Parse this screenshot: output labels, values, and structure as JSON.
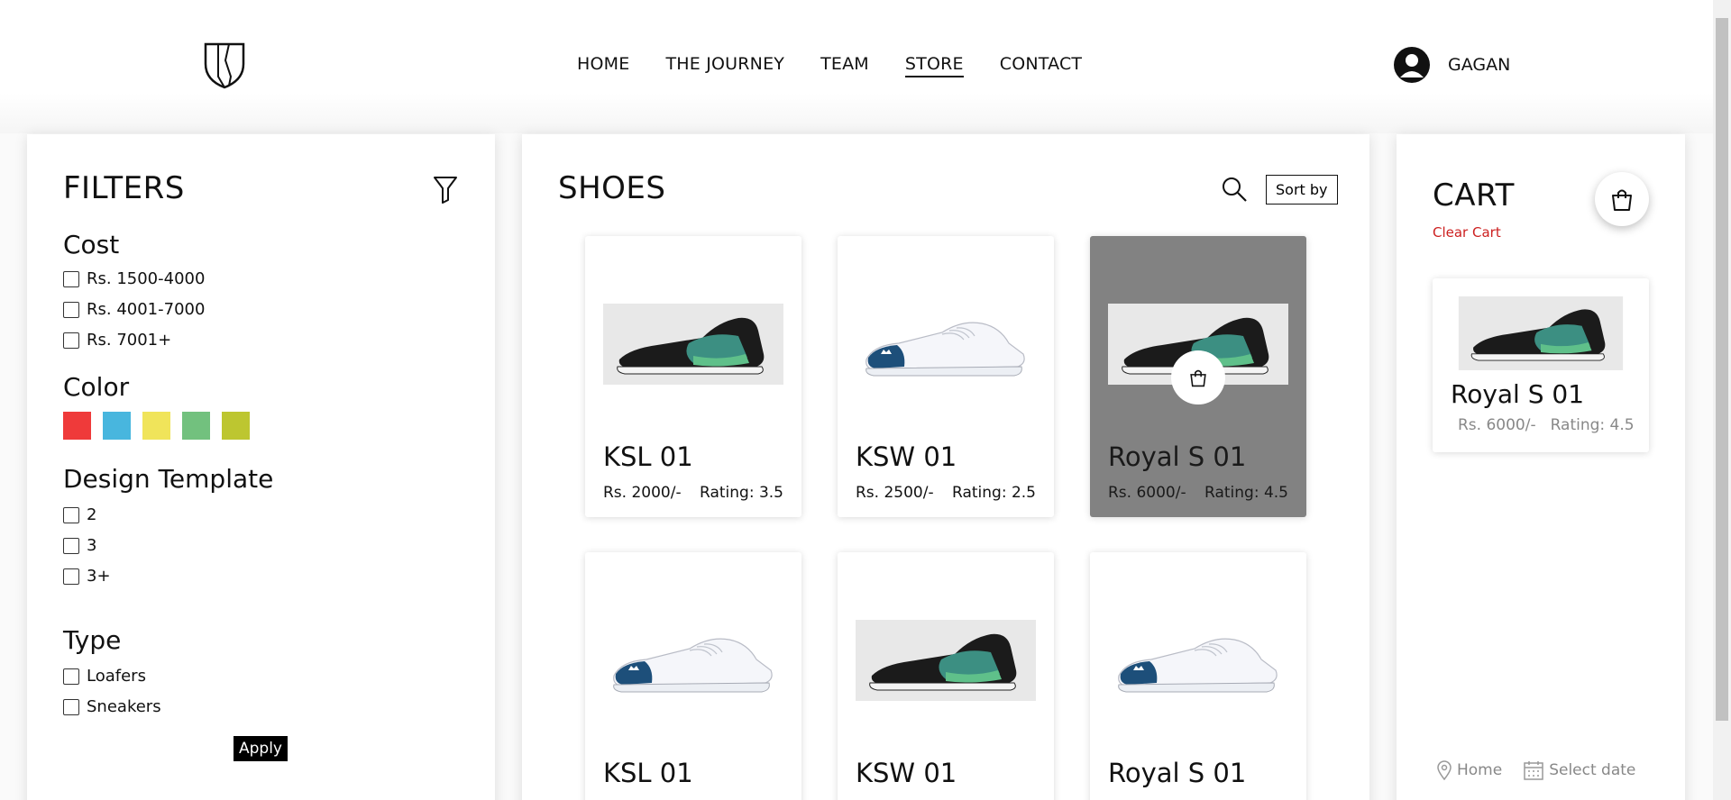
{
  "nav": {
    "items": [
      {
        "label": "HOME"
      },
      {
        "label": "THE JOURNEY"
      },
      {
        "label": "TEAM"
      },
      {
        "label": "STORE"
      },
      {
        "label": "CONTACT"
      }
    ],
    "active": "STORE",
    "user_name": "GAGAN"
  },
  "filters": {
    "title": "FILTERS",
    "cost": {
      "title": "Cost",
      "options": [
        "Rs. 1500-4000",
        "Rs. 4001-7000",
        "Rs. 7001+"
      ]
    },
    "color": {
      "title": "Color",
      "swatches": [
        "#ef3a3a",
        "#48b6de",
        "#f0e45a",
        "#72c17e",
        "#bdc630"
      ]
    },
    "design": {
      "title": "Design Template",
      "options": [
        "2",
        "3",
        "3+"
      ]
    },
    "type": {
      "title": "Type",
      "options": [
        "Loafers",
        "Sneakers"
      ]
    },
    "apply_label": "Apply"
  },
  "shoes": {
    "title": "SHOES",
    "sort_label": "Sort by",
    "products": [
      {
        "name": "KSL 01",
        "price": "Rs. 2000/-",
        "rating": "Rating: 3.5",
        "style": "sock"
      },
      {
        "name": "KSW 01",
        "price": "Rs. 2500/-",
        "rating": "Rating: 2.5",
        "style": "white"
      },
      {
        "name": "Royal S 01",
        "price": "Rs. 6000/-",
        "rating": "Rating: 4.5",
        "style": "sock",
        "selected": true
      },
      {
        "name": "KSL 01",
        "price": "",
        "rating": "",
        "style": "white"
      },
      {
        "name": "KSW 01",
        "price": "",
        "rating": "",
        "style": "sock"
      },
      {
        "name": "Royal S 01",
        "price": "",
        "rating": "",
        "style": "white"
      }
    ]
  },
  "cart": {
    "title": "CART",
    "clear_label": "Clear Cart",
    "items": [
      {
        "name": "Royal S 01",
        "price": "Rs. 6000/-",
        "rating": "Rating: 4.5"
      }
    ],
    "footer": {
      "location": "Home",
      "date": "Select date"
    }
  }
}
